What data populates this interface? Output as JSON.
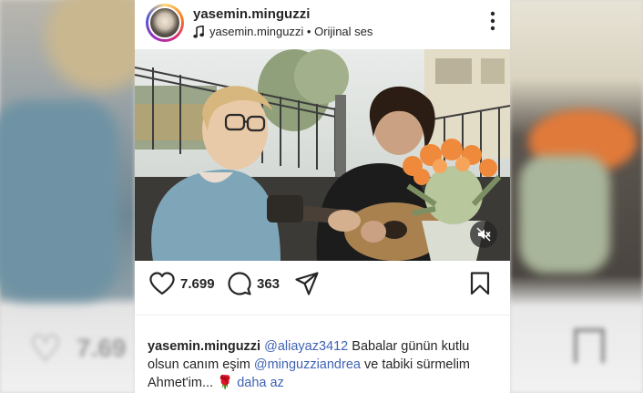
{
  "post": {
    "username": "yasemin.minguzzi",
    "audio_label": "yasemin.minguzzi • Orijinal ses",
    "likes": "7.699",
    "comments": "363",
    "caption": {
      "username": "yasemin.minguzzi",
      "mention_1": "@aliayaz3412",
      "text_1": "Babalar günün kutlu olsun canım eşim",
      "mention_2": "@minguzziandrea",
      "text_2": "ve tabiki sürmelim Ahmet'im...",
      "emoji": "🌹",
      "more_label": "daha az"
    }
  },
  "backdrop": {
    "likes_blurred": "7.69"
  },
  "colors": {
    "text": "#262626",
    "link": "#3f63b5",
    "divider": "#efefef"
  },
  "icons": [
    "more-vertical-icon",
    "music-note-icon",
    "mute-icon",
    "heart-icon",
    "comment-icon",
    "share-icon",
    "bookmark-icon"
  ]
}
